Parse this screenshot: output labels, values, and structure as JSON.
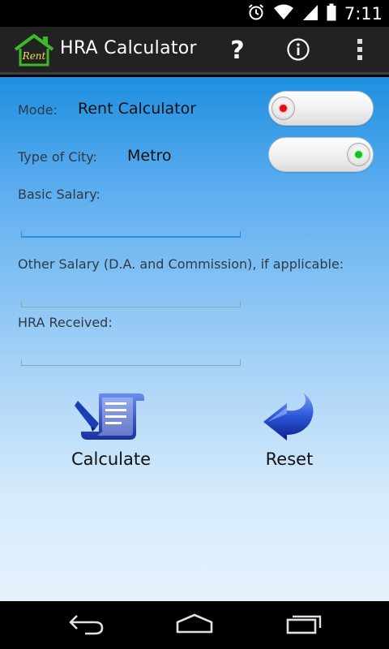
{
  "status_bar": {
    "time": "7:11",
    "icons": [
      "alarm-icon",
      "wifi-icon",
      "signal-icon",
      "battery-icon"
    ]
  },
  "action_bar": {
    "logo_text": "Rent",
    "title": "HRA Calculator",
    "actions": [
      "help-icon",
      "info-icon",
      "overflow-menu-icon"
    ]
  },
  "form": {
    "mode": {
      "label": "Mode:",
      "value": "Rent Calculator",
      "toggle_state": "off",
      "indicator_color": "#e01010"
    },
    "city": {
      "label": "Type of City:",
      "value": "Metro",
      "toggle_state": "on",
      "indicator_color": "#18c020"
    },
    "basic_salary": {
      "label": "Basic Salary:",
      "value": "",
      "focused": true
    },
    "other_salary": {
      "label": "Other Salary (D.A. and Commission), if applicable:",
      "value": ""
    },
    "hra_received": {
      "label": "HRA Received:",
      "value": ""
    }
  },
  "buttons": {
    "calculate": {
      "label": "Calculate",
      "icon": "document-pen-icon"
    },
    "reset": {
      "label": "Reset",
      "icon": "back-arrow-icon"
    }
  },
  "nav_bar": [
    "back-icon",
    "home-icon",
    "recents-icon"
  ],
  "colors": {
    "accent": "#2a8fd8",
    "content_top": "#1e8fe0",
    "content_bottom": "#e4f2fd",
    "icon_blue": "#1a3fb0"
  }
}
